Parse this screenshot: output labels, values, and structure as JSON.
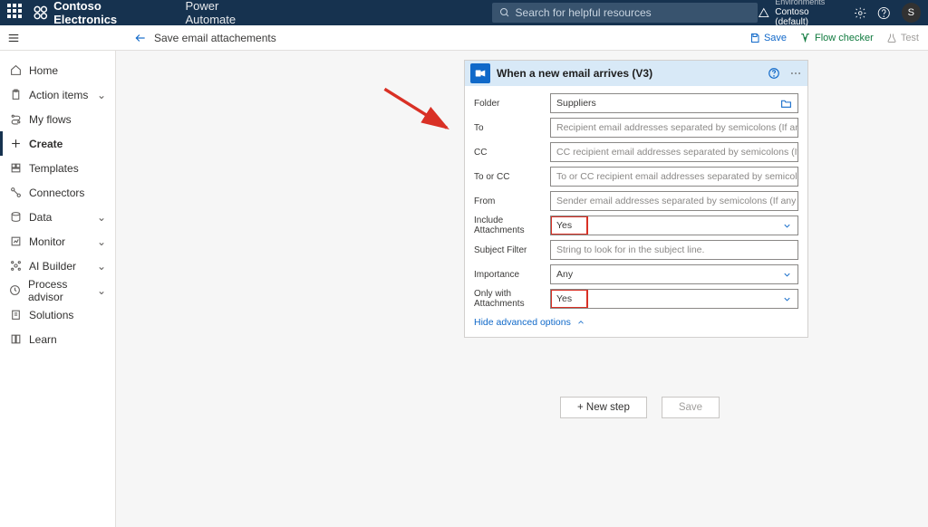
{
  "topbar": {
    "brand": "Contoso Electronics",
    "app": "Power Automate",
    "search_placeholder": "Search for helpful resources",
    "env_label": "Environments",
    "env_name": "Contoso (default)",
    "avatar_initial": "S"
  },
  "subbar": {
    "flow_name": "Save email attachements",
    "save": "Save",
    "flow_checker": "Flow checker",
    "test": "Test"
  },
  "sidebar": {
    "items": [
      {
        "label": "Home"
      },
      {
        "label": "Action items"
      },
      {
        "label": "My flows"
      },
      {
        "label": "Create"
      },
      {
        "label": "Templates"
      },
      {
        "label": "Connectors"
      },
      {
        "label": "Data"
      },
      {
        "label": "Monitor"
      },
      {
        "label": "AI Builder"
      },
      {
        "label": "Process advisor"
      },
      {
        "label": "Solutions"
      },
      {
        "label": "Learn"
      }
    ]
  },
  "card": {
    "title": "When a new email arrives (V3)",
    "fields": {
      "folder_label": "Folder",
      "folder_value": "Suppliers",
      "to_label": "To",
      "to_placeholder": "Recipient email addresses separated by semicolons (If any match, the",
      "cc_label": "CC",
      "cc_placeholder": "CC recipient email addresses separated by semicolons (If any match,",
      "tocc_label": "To or CC",
      "tocc_placeholder": "To or CC recipient email addresses separated by semicolons (If any m",
      "from_label": "From",
      "from_placeholder": "Sender email addresses separated by semicolons (If any match, the tr",
      "incl_label": "Include Attachments",
      "incl_value": "Yes",
      "subj_label": "Subject Filter",
      "subj_placeholder": "String to look for in the subject line.",
      "imp_label": "Importance",
      "imp_value": "Any",
      "only_label": "Only with Attachments",
      "only_value": "Yes"
    },
    "adv_link": "Hide advanced options"
  },
  "buttons": {
    "new_step": "+ New step",
    "save": "Save"
  }
}
